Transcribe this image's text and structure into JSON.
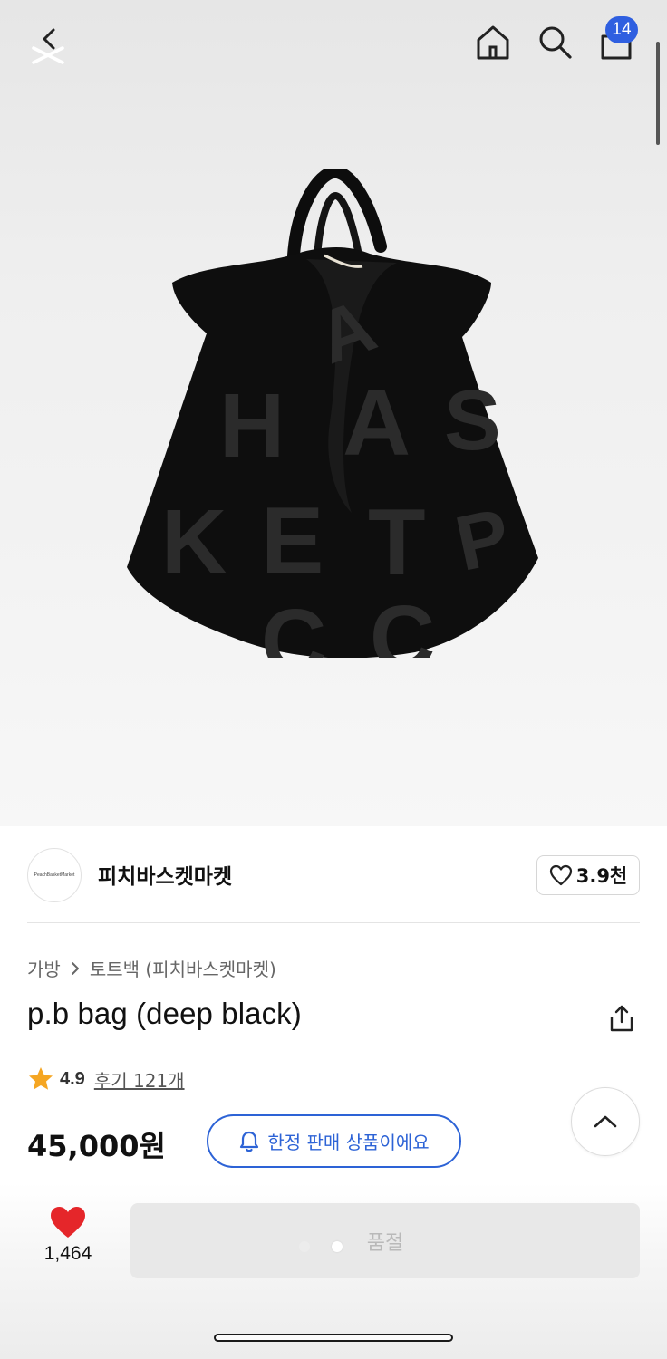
{
  "header": {
    "cart_count": "14",
    "icons": [
      "close-icon",
      "back-chevron-icon",
      "home-icon",
      "search-icon",
      "shopping-bag-icon"
    ]
  },
  "product_image": {
    "letters": [
      "A",
      "H",
      "A",
      "S",
      "K",
      "E",
      "T",
      "P",
      "C",
      "C"
    ]
  },
  "seller": {
    "logo_text": "PeachBasketMarket",
    "name": "피치바스켓마켓",
    "follow_count": "3.9천"
  },
  "breadcrumb": {
    "category": "가방",
    "subcategory": "토트백 (피치바스켓마켓)"
  },
  "product": {
    "title": "p.b bag (deep black)",
    "rating": "4.9",
    "reviews_label": "후기 121개",
    "price": "45,000원",
    "limited_label": "한정 판매 상품이에요"
  },
  "bottom_bar": {
    "like_count": "1,464",
    "action_label": "품절",
    "page_dots_active_index": 1
  },
  "colors": {
    "accent_blue": "#2d63d6",
    "badge_blue": "#2f5fe0",
    "heart_red": "#e5262a",
    "star_orange": "#f5a623"
  }
}
